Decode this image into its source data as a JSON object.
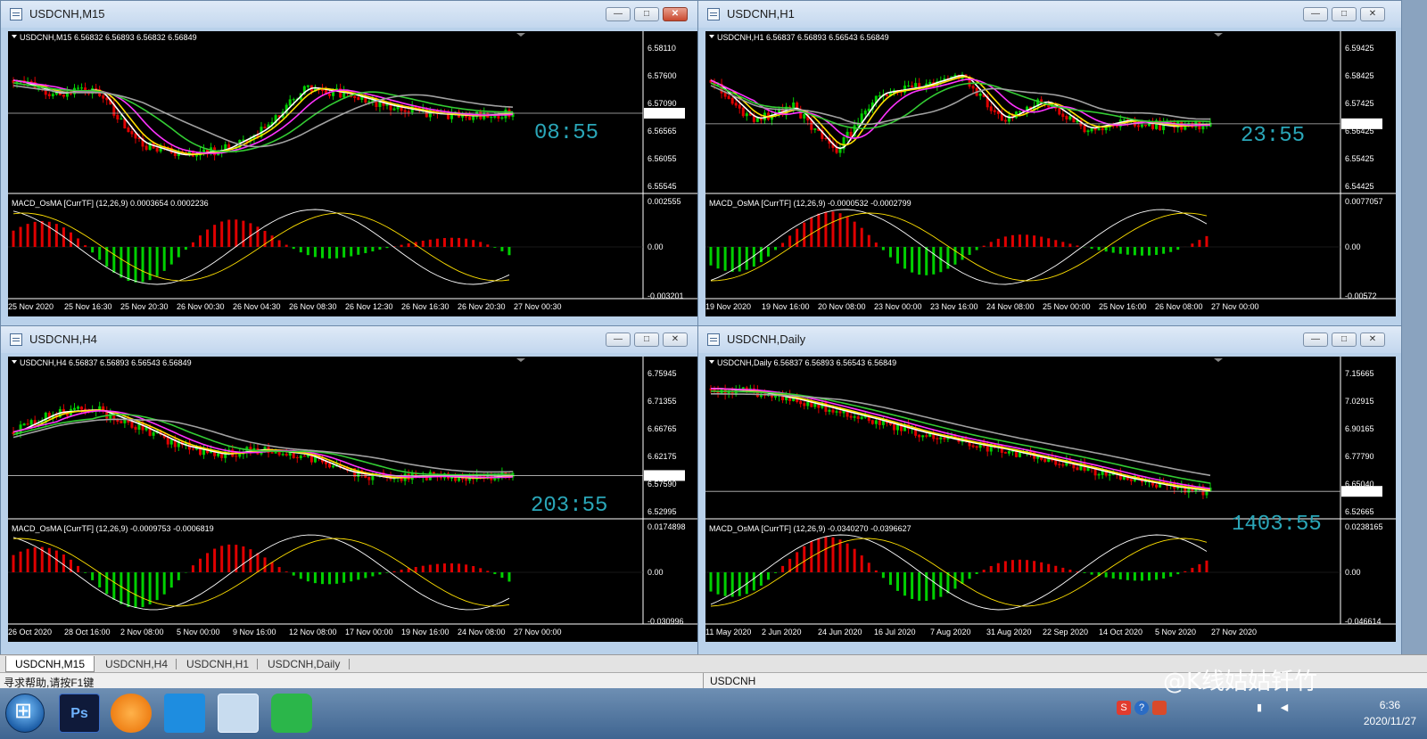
{
  "windows": [
    {
      "title": "USDCNH,M15",
      "header": "USDCNH,M15  6.56832 6.56893 6.56832 6.56849",
      "timer": "08:55",
      "price_labels": [
        "6.58110",
        "6.57600",
        "6.57090",
        "6.56565",
        "6.56055",
        "6.55545"
      ],
      "current_price": "6.56849",
      "macd_header": "MACD_OsMA [CurrTF] (12,26,9) 0.0003654 0.0002236",
      "macd_labels": [
        "0.002555",
        "0.00",
        "-0.003201"
      ],
      "time_labels": [
        "25 Nov 2020",
        "25 Nov 16:30",
        "25 Nov 20:30",
        "26 Nov 00:30",
        "26 Nov 04:30",
        "26 Nov 08:30",
        "26 Nov 12:30",
        "26 Nov 16:30",
        "26 Nov 20:30",
        "27 Nov 00:30"
      ]
    },
    {
      "title": "USDCNH,H1",
      "header": "USDCNH,H1  6.56837 6.56893 6.56543 6.56849",
      "timer": "23:55",
      "price_labels": [
        "6.59425",
        "6.58425",
        "6.57425",
        "6.56425",
        "6.55425",
        "6.54425"
      ],
      "current_price": "6.56849",
      "macd_header": "MACD_OsMA [CurrTF] (12,26,9) -0.0000532 -0.0002799",
      "macd_labels": [
        "0.0077057",
        "0.00",
        "-0.00572"
      ],
      "time_labels": [
        "19 Nov 2020",
        "19 Nov 16:00",
        "20 Nov 08:00",
        "23 Nov 00:00",
        "23 Nov 16:00",
        "24 Nov 08:00",
        "25 Nov 00:00",
        "25 Nov 16:00",
        "26 Nov 08:00",
        "27 Nov 00:00"
      ]
    },
    {
      "title": "USDCNH,H4",
      "header": "USDCNH,H4  6.56837 6.56893 6.56543 6.56849",
      "timer": "203:55",
      "price_labels": [
        "6.75945",
        "6.71355",
        "6.66765",
        "6.62175",
        "6.57590",
        "6.52995"
      ],
      "current_price": "6.56849",
      "macd_header": "MACD_OsMA [CurrTF] (12,26,9) -0.0009753 -0.0006819",
      "macd_labels": [
        "0.0174898",
        "0.00",
        "-0.030996"
      ],
      "time_labels": [
        "26 Oct 2020",
        "28 Oct 16:00",
        "2 Nov 08:00",
        "5 Nov 00:00",
        "9 Nov 16:00",
        "12 Nov 08:00",
        "17 Nov 00:00",
        "19 Nov 16:00",
        "24 Nov 08:00",
        "27 Nov 00:00"
      ]
    },
    {
      "title": "USDCNH,Daily",
      "header": "USDCNH,Daily  6.56837 6.56893 6.56543 6.56849",
      "timer": "1403:55",
      "price_labels": [
        "7.15665",
        "7.02915",
        "6.90165",
        "6.77790",
        "6.65040",
        "6.52665"
      ],
      "current_price": "6.56849",
      "macd_header": "MACD_OsMA [CurrTF] (12,26,9) -0.0340270 -0.0396627",
      "macd_labels": [
        "0.0238165",
        "0.00",
        "-0.046614"
      ],
      "time_labels": [
        "11 May 2020",
        "2 Jun 2020",
        "24 Jun 2020",
        "16 Jul 2020",
        "7 Aug 2020",
        "31 Aug 2020",
        "22 Sep 2020",
        "14 Oct 2020",
        "5 Nov 2020",
        "27 Nov 2020"
      ]
    }
  ],
  "tabs": [
    "USDCNH,M15",
    "USDCNH,H4",
    "USDCNH,H1",
    "USDCNH,Daily"
  ],
  "active_tab": "USDCNH,M15",
  "status": {
    "help": "寻求帮助,请按F1键",
    "symbol": "USDCNH"
  },
  "taskbar": {
    "apps": [
      "start-orb-icon",
      "photoshop-icon",
      "app-orange-icon",
      "app-blue-icon",
      "metatrader-icon",
      "wechat-icon"
    ],
    "ps_label": "Ps",
    "time": "6:36",
    "date": "2020/11/27"
  },
  "watermark": "@K线姑姑钎竹",
  "colors": {
    "bull": "#00d000",
    "bear": "#e00000",
    "ma_white": "#ffffff",
    "ma_yellow": "#ffe000",
    "ma_magenta": "#ff33ff",
    "ma_green": "#33cc33",
    "ma_gray": "#a0a0a0",
    "timer": "#2aa6b8"
  }
}
